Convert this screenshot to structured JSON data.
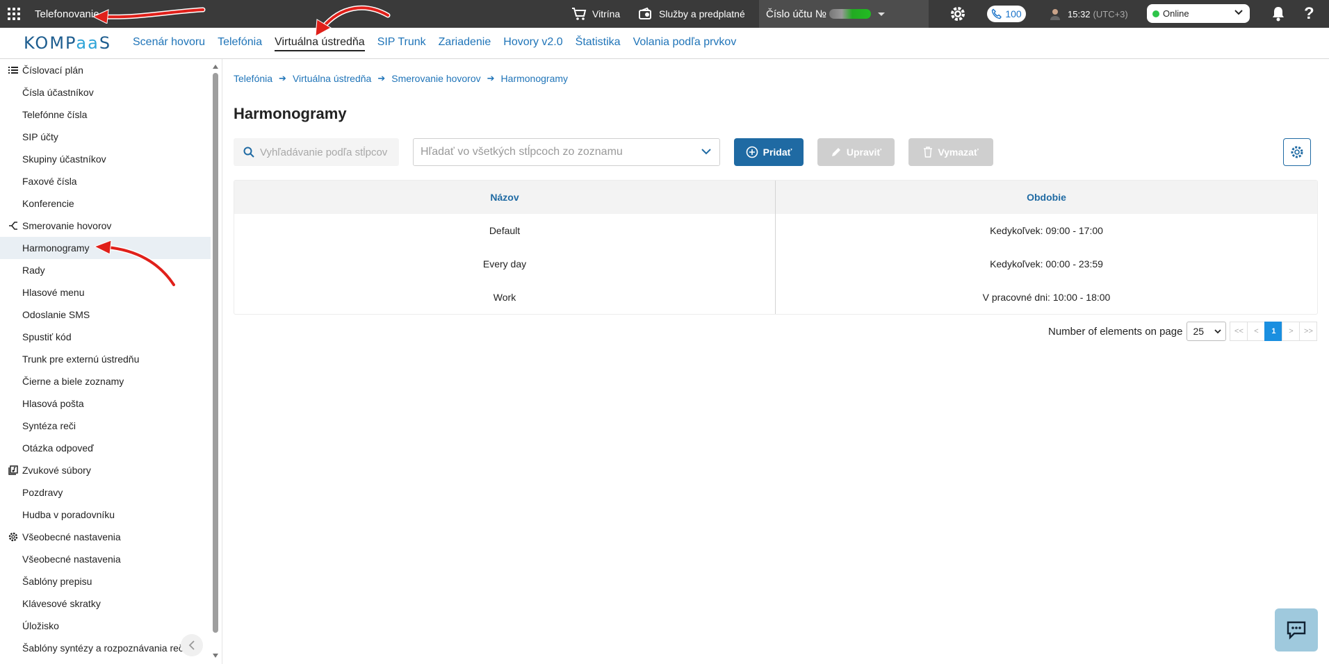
{
  "topbar": {
    "app_title": "Telefonovanie",
    "shop_label": "Vitrína",
    "services_label": "Služby a predplatné",
    "account_label": "Číslo účtu №",
    "call_count": "100",
    "time": "15:32",
    "timezone": "(UTC+3)",
    "status": "Online"
  },
  "brand": {
    "logo_left": "KOMP",
    "logo_mid": "aa",
    "logo_right": "S"
  },
  "nav": {
    "items": [
      {
        "label": "Scenár hovoru"
      },
      {
        "label": "Telefónia"
      },
      {
        "label": "Virtuálna ústredňa"
      },
      {
        "label": "SIP Trunk"
      },
      {
        "label": "Zariadenie"
      },
      {
        "label": "Hovory v2.0"
      },
      {
        "label": "Štatistika"
      },
      {
        "label": "Volania podľa prvkov"
      }
    ],
    "active": "Virtuálna ústredňa"
  },
  "sidebar": {
    "groups": [
      {
        "label": "Číslovací plán"
      },
      {
        "label": "Smerovanie hovorov"
      },
      {
        "label": "Zvukové súbory"
      },
      {
        "label": "Všeobecné nastavenia"
      }
    ],
    "items": [
      {
        "label": "Čísla účastníkov"
      },
      {
        "label": "Telefónne čísla"
      },
      {
        "label": "SIP účty"
      },
      {
        "label": "Skupiny účastníkov"
      },
      {
        "label": "Faxové čísla"
      },
      {
        "label": "Konferencie"
      },
      {
        "label": "Harmonogramy"
      },
      {
        "label": "Rady"
      },
      {
        "label": "Hlasové menu"
      },
      {
        "label": "Odoslanie SMS"
      },
      {
        "label": "Spustiť kód"
      },
      {
        "label": "Trunk pre externú ústredňu"
      },
      {
        "label": "Čierne a biele zoznamy"
      },
      {
        "label": "Hlasová pošta"
      },
      {
        "label": "Syntéza reči"
      },
      {
        "label": "Otázka odpoveď"
      },
      {
        "label": "Pozdravy"
      },
      {
        "label": "Hudba v poradovníku"
      },
      {
        "label": "Všeobecné nastavenia"
      },
      {
        "label": "Šablóny prepisu"
      },
      {
        "label": "Klávesové skratky"
      },
      {
        "label": "Úložisko"
      },
      {
        "label": "Šablóny syntézy a rozpoznávania reč."
      }
    ],
    "active": "Harmonogramy"
  },
  "breadcrumb": [
    "Telefónia",
    "Virtuálna ústredňa",
    "Smerovanie hovorov",
    "Harmonogramy"
  ],
  "page": {
    "title": "Harmonogramy"
  },
  "toolbar": {
    "search_placeholder": "Vyhľadávanie podľa stĺpcov",
    "column_select_placeholder": "Hľadať vo všetkých stĺpcoch zo zoznamu",
    "add_label": "Pridať",
    "edit_label": "Upraviť",
    "delete_label": "Vymazať"
  },
  "table": {
    "columns": [
      "Názov",
      "Obdobie"
    ],
    "rows": [
      [
        "Default",
        "Kedykoľvek: 09:00 - 17:00"
      ],
      [
        "Every day",
        "Kedykoľvek: 00:00 - 23:59"
      ],
      [
        "Work",
        "V pracovné dni: 10:00 - 18:00"
      ]
    ]
  },
  "pager": {
    "label": "Number of elements on page",
    "page_size": "25",
    "first": "<<",
    "prev": "<",
    "current": "1",
    "next": ">",
    "last": ">>"
  },
  "colors": {
    "accent": "#1f6aa3",
    "link": "#1f74b8",
    "topbar": "#3a3a3a",
    "online": "#2ec44a",
    "annotation": "#e0201a"
  }
}
